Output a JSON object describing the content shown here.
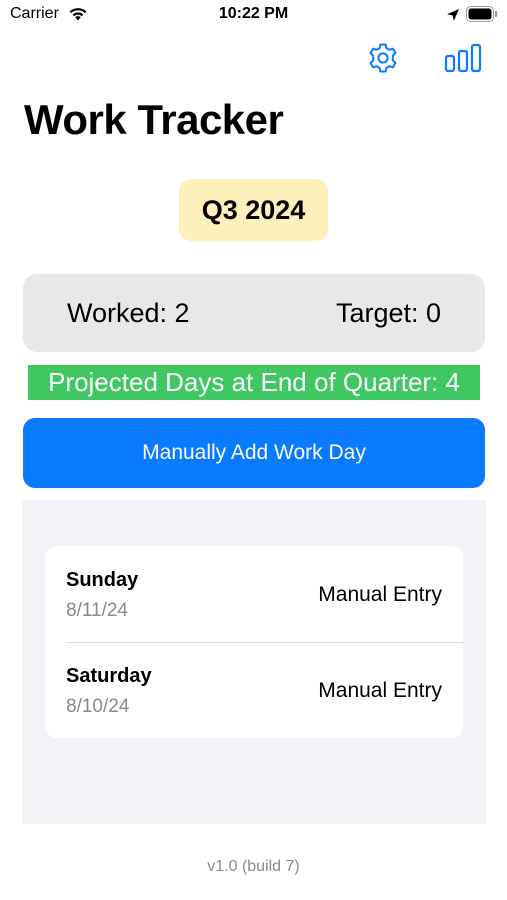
{
  "status_bar": {
    "carrier": "Carrier",
    "time": "10:22 PM"
  },
  "toolbar": {
    "settings_icon": "gear-icon",
    "stats_icon": "bar-chart-icon"
  },
  "header": {
    "title": "Work Tracker"
  },
  "quarter": {
    "label": "Q3 2024"
  },
  "summary": {
    "worked": "Worked: 2",
    "target": "Target: 0"
  },
  "projection": {
    "text": "Projected Days at End of Quarter: 4"
  },
  "actions": {
    "add_day_label": "Manually Add Work Day"
  },
  "entries": [
    {
      "day": "Sunday",
      "date": "8/11/24",
      "type": "Manual Entry"
    },
    {
      "day": "Saturday",
      "date": "8/10/24",
      "type": "Manual Entry"
    }
  ],
  "footer": {
    "version": "v1.0 (build 7)"
  },
  "colors": {
    "accent": "#0a7aff",
    "quarter_bg": "#fdf0bb",
    "projection_bg": "#3fc862",
    "summary_bg": "#e8e8e8",
    "list_bg": "#f2f2f7"
  }
}
